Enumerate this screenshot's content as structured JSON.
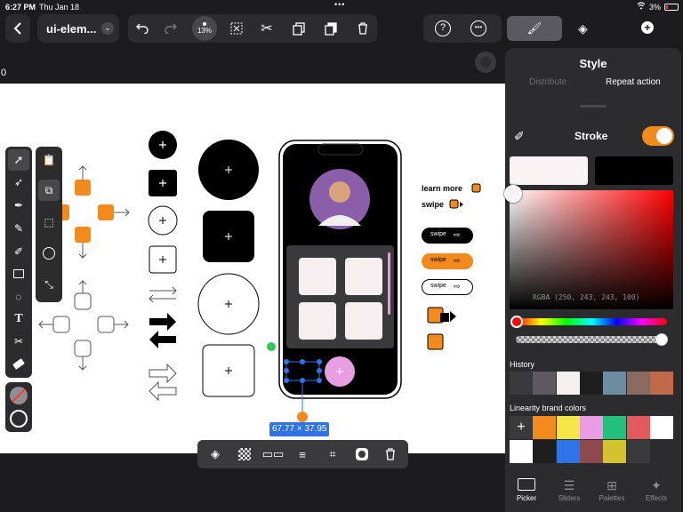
{
  "status": {
    "time": "6:27 PM",
    "date": "Thu Jan 18",
    "battery": "3%"
  },
  "topbar": {
    "back_icon": "chevron-left-icon",
    "doc_title": "ui-elem...",
    "zoom": "13%"
  },
  "ruler_label": "0",
  "panel": {
    "title": "Style",
    "tab_distribute": "Distribute",
    "tab_repeat": "Repeat action",
    "stroke_label": "Stroke",
    "rgba_readout": "RGBA (250, 243, 243, 100)",
    "history_label": "History",
    "brand_label": "Linearity brand colors",
    "tabs": [
      {
        "label": "Picker",
        "icon": "picker-icon"
      },
      {
        "label": "Sliders",
        "icon": "sliders-icon"
      },
      {
        "label": "Palettes",
        "icon": "palettes-icon"
      },
      {
        "label": "Effects",
        "icon": "effects-icon"
      }
    ],
    "history_colors": [
      "#3a3a3c",
      "#5e5a60",
      "#f5f0f0",
      "#1e1e1e",
      "#6c8ea0",
      "#8a6a5e",
      "#c06a4a"
    ],
    "brand_colors_row1": [
      "#f28a1c",
      "#f5e64a",
      "#ea9ce6",
      "#22c07a",
      "#e05a5e",
      "#ffffff"
    ],
    "brand_colors_row2": [
      "#ffffff",
      "#1e1e1e",
      "#2f73e8",
      "#8a4a4e",
      "#d4c22e",
      "#3a3a3c"
    ],
    "stroke_fill": "#faf3f3",
    "stroke_alt": "#000000",
    "accent": "#f28a1c"
  },
  "canvas": {
    "learn_more": "learn more",
    "swipe": "swipe",
    "pill_swipe_1": "swipe",
    "pill_swipe_2": "swipe",
    "pill_swipe_3": "swipe",
    "dimensions": "67.77 × 37.95"
  }
}
